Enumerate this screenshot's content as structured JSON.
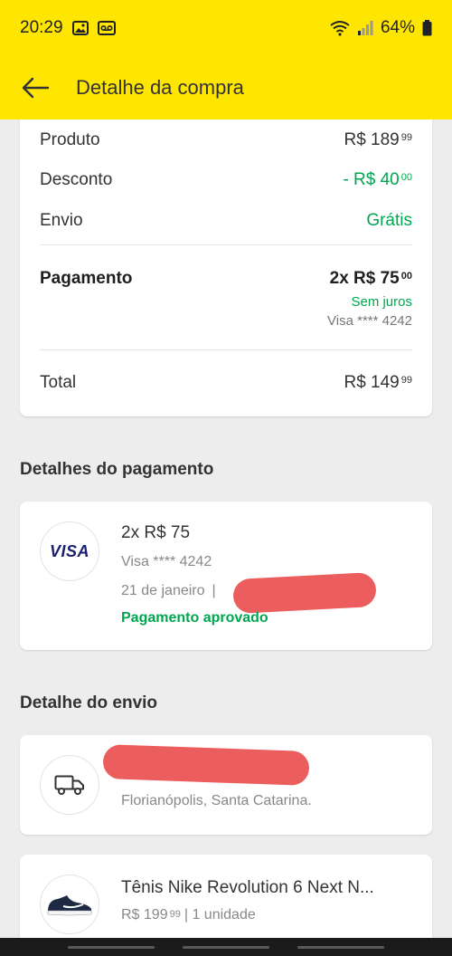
{
  "status_bar": {
    "time": "20:29",
    "battery": "64%",
    "icons": [
      "gallery-icon",
      "voicemail-icon",
      "wifi-icon",
      "signal-icon",
      "battery-icon"
    ]
  },
  "header": {
    "title": "Detalhe da compra",
    "back_icon": "arrow-left-icon"
  },
  "summary": {
    "product_label": "Produto",
    "product_value": "R$ 189",
    "product_cents": "99",
    "discount_label": "Desconto",
    "discount_value": "- R$ 40",
    "discount_cents": "00",
    "shipping_label": "Envio",
    "shipping_value": "Grátis",
    "payment_label": "Pagamento",
    "payment_value": "2x R$ 75",
    "payment_cents": "00",
    "payment_interest": "Sem juros",
    "payment_card": "Visa **** 4242",
    "total_label": "Total",
    "total_value": "R$ 149",
    "total_cents": "99"
  },
  "payment_details": {
    "section_title": "Detalhes do pagamento",
    "logo_text": "VISA",
    "amount": "2x R$ 75",
    "card": "Visa **** 4242",
    "date": "21 de janeiro",
    "separator": "|",
    "status": "Pagamento aprovado"
  },
  "shipping_details": {
    "section_title": "Detalhe do envio",
    "location": "Florianópolis, Santa Catarina.",
    "icon": "truck-icon"
  },
  "product": {
    "name": "Tênis Nike Revolution 6 Next N...",
    "price": "R$ 199",
    "price_cents": "99",
    "quantity": "| 1 unidade"
  },
  "colors": {
    "brand_yellow": "#ffe600",
    "success_green": "#00a650",
    "redaction": "#ec5d5d"
  }
}
